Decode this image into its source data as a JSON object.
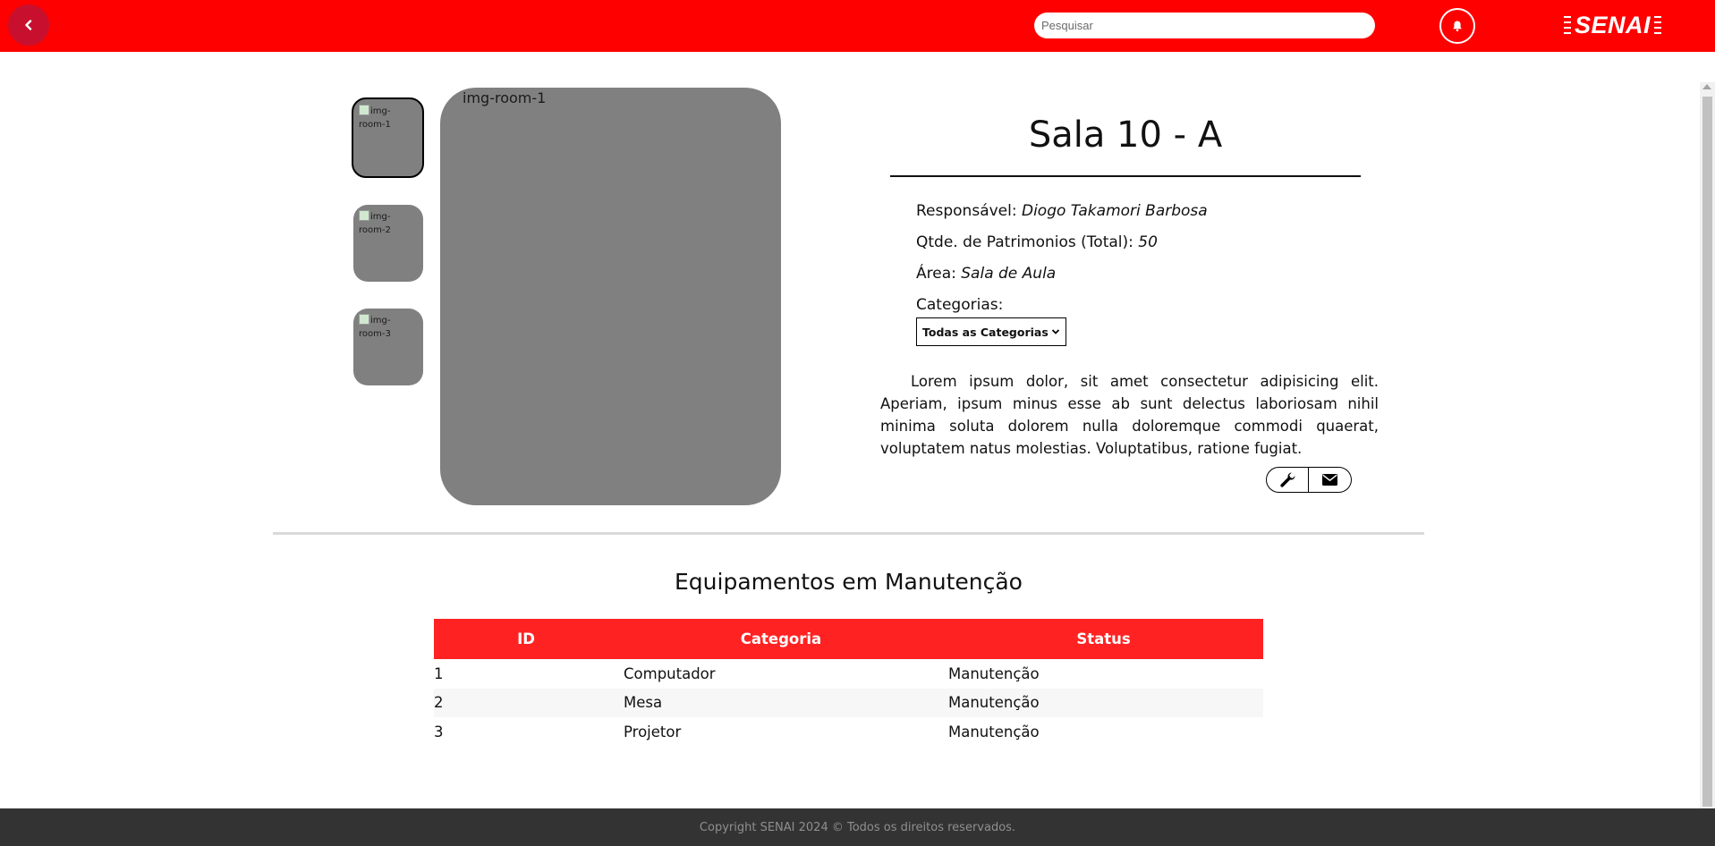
{
  "header": {
    "search_placeholder": "Pesquisar",
    "logo_text": "SENAI",
    "icons": {
      "back": "chevron-left-icon",
      "notifications": "bell-icon"
    },
    "background_color": "#ff0000"
  },
  "gallery": {
    "thumbnails": [
      {
        "alt": "img-room-1",
        "selected": true
      },
      {
        "alt": "img-room-2",
        "selected": false
      },
      {
        "alt": "img-room-3",
        "selected": false
      }
    ],
    "main_image_alt": "img-room-1"
  },
  "room": {
    "title": "Sala 10 - A",
    "responsavel_label": "Responsável:",
    "responsavel_value": "Diogo Takamori Barbosa",
    "patrimonios_label": "Qtde. de Patrimonios (Total):",
    "patrimonios_value": "50",
    "area_label": "Área:",
    "area_value": "Sala de Aula",
    "categorias_label": "Categorias:",
    "categoria_selected": "Todas as Categorias",
    "description": "Lorem ipsum dolor, sit amet consectetur adipisicing elit. Aperiam, ipsum minus esse ab sunt delectus laboriosam nihil minima soluta dolorem nulla doloremque commodi quaerat, voluptatem natus molestias. Voluptatibus, ratione fugiat.",
    "actions": {
      "maintenance": "wrench-icon",
      "message": "envelope-icon"
    }
  },
  "maintenance": {
    "title": "Equipamentos em Manutenção",
    "columns": [
      "ID",
      "Categoria",
      "Status"
    ],
    "rows": [
      {
        "id": "1",
        "categoria": "Computador",
        "status": "Manutenção"
      },
      {
        "id": "2",
        "categoria": "Mesa",
        "status": "Manutenção"
      },
      {
        "id": "3",
        "categoria": "Projetor",
        "status": "Manutenção"
      }
    ],
    "header_color": "#ff2222"
  },
  "footer": {
    "text": "Copyright SENAI 2024 © Todos os direitos reservados."
  }
}
